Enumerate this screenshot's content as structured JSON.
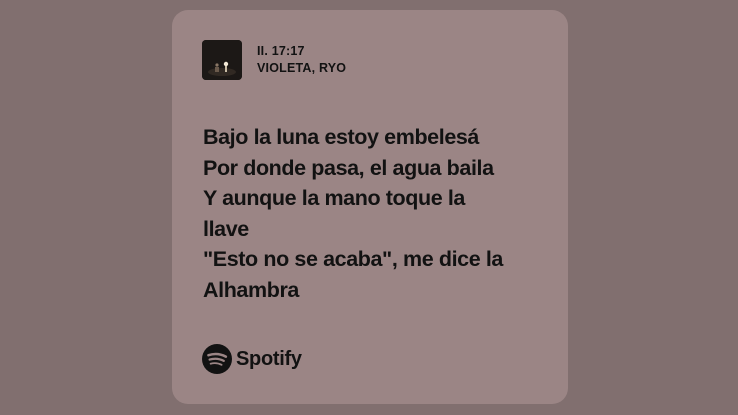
{
  "track": {
    "title": "II. 17:17",
    "artist": "VIOLETA, RYO"
  },
  "lyrics": [
    "Bajo la luna estoy embelesá",
    "Por donde pasa, el agua baila",
    "Y aunque la mano toque la",
    "llave",
    "\"Esto no se acaba\", me dice la",
    "Alhambra"
  ],
  "brand": {
    "name": "Spotify",
    "icon": "spotify-logo-icon"
  },
  "colors": {
    "background": "#816f6f",
    "card": "#9b8585",
    "text": "#121212"
  }
}
